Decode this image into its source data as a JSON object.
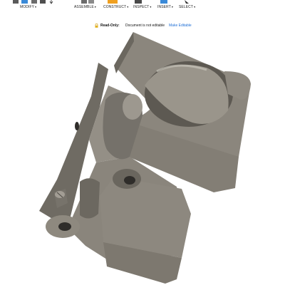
{
  "toolbar": {
    "menus": {
      "modify": "MODIFY",
      "assemble": "ASSEMBLE",
      "construct": "CONSTRUCT",
      "inspect": "INSPECT",
      "insert": "INSERT",
      "select": "SELECT"
    },
    "caret": "▾"
  },
  "readonly_bar": {
    "label": "Read-Only:",
    "message": "Document is not editable",
    "make_editable": "Make Editable"
  },
  "colors": {
    "model_body": "#8a857c",
    "model_shadow": "#5e5a53",
    "model_light": "#a9a49b",
    "link": "#1f6fd6"
  },
  "icons": [
    "modify-icon",
    "assemble-icon",
    "construct-icon",
    "inspect-icon",
    "insert-icon",
    "select-icon",
    "lock-icon"
  ]
}
